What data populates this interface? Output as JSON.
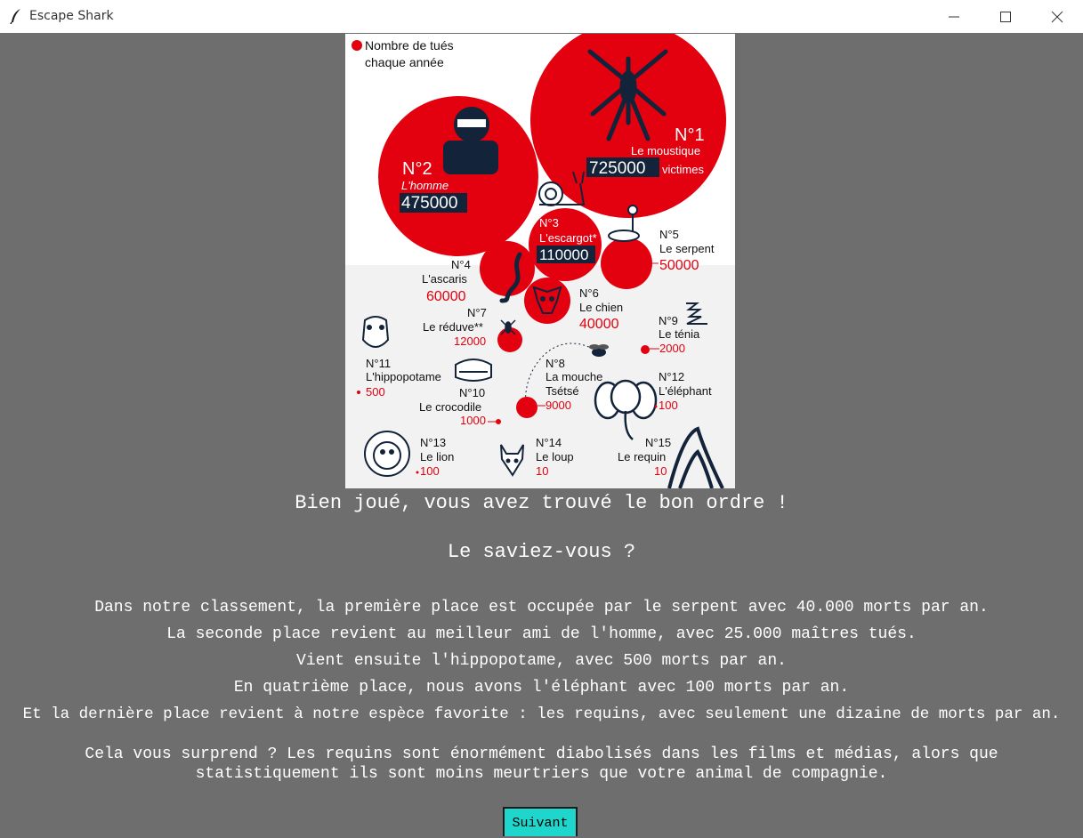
{
  "window": {
    "title": "Escape Shark",
    "app_icon": "feather-icon",
    "controls": [
      "minimize-icon",
      "maximize-icon",
      "close-icon"
    ]
  },
  "infographic": {
    "legend": "Nombre de tués chaque année",
    "legend_line1": "Nombre de tués",
    "legend_line2": "chaque année",
    "accent_color": "#e3000f",
    "animals": [
      {
        "rank": "N°1",
        "name": "Le moustique",
        "value": "725000",
        "suffix": "victimes"
      },
      {
        "rank": "N°2",
        "name": "L'homme",
        "value": "475000"
      },
      {
        "rank": "N°3",
        "name": "L'escargot*",
        "value": "110000"
      },
      {
        "rank": "N°4",
        "name": "L'ascaris",
        "value": "60000"
      },
      {
        "rank": "N°5",
        "name": "Le serpent",
        "value": "50000"
      },
      {
        "rank": "N°6",
        "name": "Le chien",
        "value": "40000"
      },
      {
        "rank": "N°7",
        "name": "Le réduve**",
        "value": "12000"
      },
      {
        "rank": "N°8",
        "name": "La mouche Tsétsé",
        "name_line1": "La mouche",
        "name_line2": "Tsétsé",
        "value": "9000"
      },
      {
        "rank": "N°9",
        "name": "Le ténia",
        "value": "2000"
      },
      {
        "rank": "N°10",
        "name": "Le crocodile",
        "value": "1000"
      },
      {
        "rank": "N°11",
        "name": "L'hippopotame",
        "value": "500"
      },
      {
        "rank": "N°12",
        "name": "L'éléphant",
        "value": "100"
      },
      {
        "rank": "N°13",
        "name": "Le lion",
        "value": "100"
      },
      {
        "rank": "N°14",
        "name": "Le loup",
        "value": "10"
      },
      {
        "rank": "N°15",
        "name": "Le requin",
        "value": "10"
      }
    ]
  },
  "messages": {
    "success": "Bien joué, vous avez trouvé le bon ordre !",
    "did_you_know": "Le saviez-vous ?",
    "facts": [
      "Dans notre classement, la première place est occupée par le serpent avec 40.000 morts par an.",
      "La seconde place revient au meilleur ami de l'homme, avec 25.000 maîtres tués.",
      "Vient ensuite l'hippopotame, avec 500 morts par an.",
      "En quatrième place, nous avons l'éléphant avec 100 morts par an.",
      "Et la dernière place revient à notre espèce favorite : les requins, avec seulement une dizaine de morts par an.",
      "Cela vous surprend ? Les requins sont énormément diabolisés dans les films et médias, alors que statistiquement ils sont moins meurtriers que votre animal de compagnie."
    ]
  },
  "buttons": {
    "next_label": "Suivant",
    "next_color": "#1fd6cc"
  }
}
